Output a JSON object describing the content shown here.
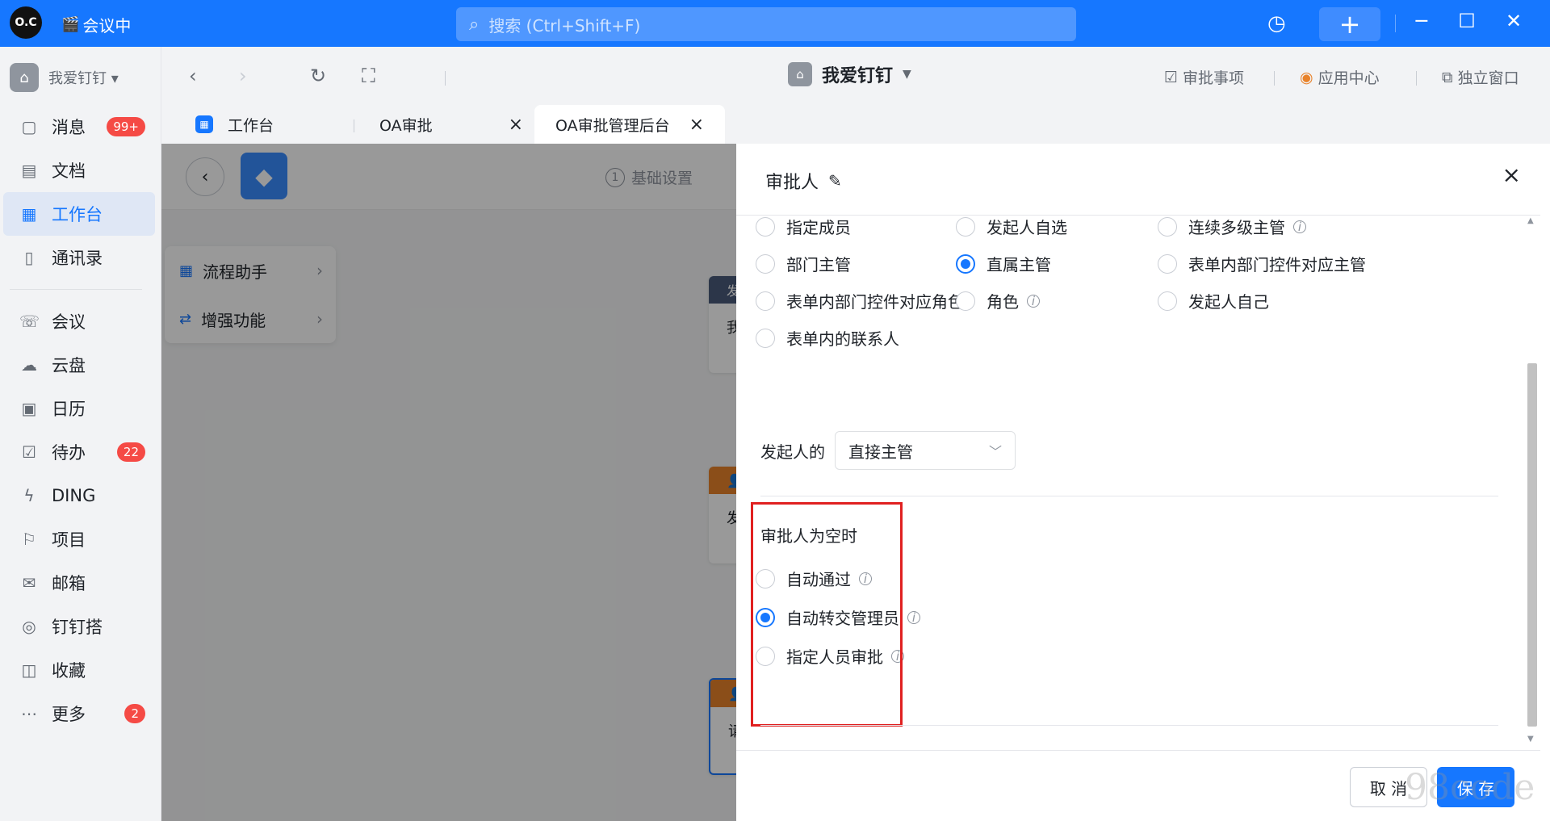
{
  "titlebar": {
    "logo_text": "O.C",
    "meeting_label": "会议中",
    "search_placeholder": "搜索 (Ctrl+Shift+F)",
    "add_label": "+",
    "minimize": "─",
    "maximize": "☐",
    "close": "✕"
  },
  "sidebar": {
    "org_name": "我爱钉钉 ▾",
    "items": [
      {
        "label": "消息",
        "icon": "message-icon",
        "glyph": "▢",
        "badge": "99+"
      },
      {
        "label": "文档",
        "icon": "doc-icon",
        "glyph": "▤",
        "badge": ""
      },
      {
        "label": "工作台",
        "icon": "workbench-icon",
        "glyph": "▦",
        "badge": "",
        "active": true
      },
      {
        "label": "通讯录",
        "icon": "contacts-icon",
        "glyph": "▯",
        "badge": ""
      },
      {
        "label": "会议",
        "icon": "meeting-icon",
        "glyph": "☏",
        "badge": ""
      },
      {
        "label": "云盘",
        "icon": "cloud-icon",
        "glyph": "☁",
        "badge": ""
      },
      {
        "label": "日历",
        "icon": "calendar-icon",
        "glyph": "▣",
        "badge": ""
      },
      {
        "label": "待办",
        "icon": "todo-icon",
        "glyph": "☑",
        "badge": "22"
      },
      {
        "label": "DING",
        "icon": "ding-icon",
        "glyph": "ϟ",
        "badge": ""
      },
      {
        "label": "项目",
        "icon": "project-icon",
        "glyph": "⚐",
        "badge": ""
      },
      {
        "label": "邮箱",
        "icon": "mail-icon",
        "glyph": "✉",
        "badge": ""
      },
      {
        "label": "钉钉搭",
        "icon": "builder-icon",
        "glyph": "◎",
        "badge": ""
      },
      {
        "label": "收藏",
        "icon": "favorites-icon",
        "glyph": "◫",
        "badge": ""
      },
      {
        "label": "更多",
        "icon": "more-icon",
        "glyph": "⋯",
        "badge": "2"
      }
    ]
  },
  "browser": {
    "back": "‹",
    "forward": "›",
    "refresh": "↻",
    "fullscreen": "⛶",
    "workspace_name": "我爱钉钉",
    "approval_items": "审批事项",
    "app_center": "应用中心",
    "standalone": "独立窗口",
    "tabs": [
      {
        "label": "工作台"
      },
      {
        "label": "OA审批"
      },
      {
        "label": "OA审批管理后台"
      }
    ]
  },
  "content": {
    "step_num": "1",
    "step_label": "基础设置",
    "menu": [
      {
        "label": "流程助手",
        "icon": "flow-icon"
      },
      {
        "label": "增强功能",
        "icon": "enhance-icon"
      }
    ],
    "nodes": [
      {
        "head": "发",
        "body": "我",
        "color": "#4a5a7a"
      },
      {
        "head": "👤",
        "body": "发",
        "color": "#e8822a"
      },
      {
        "head": "👤",
        "body": "请",
        "color": "#e8822a"
      }
    ]
  },
  "drawer": {
    "title": "审批人",
    "approver_types": [
      {
        "label": "指定成员",
        "checked": false,
        "info": false
      },
      {
        "label": "发起人自选",
        "checked": false,
        "info": false
      },
      {
        "label": "连续多级主管",
        "checked": false,
        "info": true
      },
      {
        "label": "部门主管",
        "checked": false,
        "info": false
      },
      {
        "label": "直属主管",
        "checked": true,
        "info": false
      },
      {
        "label": "表单内部门控件对应主管",
        "checked": false,
        "info": false
      },
      {
        "label": "表单内部门控件对应角色",
        "checked": false,
        "info": false
      },
      {
        "label": "角色",
        "checked": false,
        "info": true
      },
      {
        "label": "发起人自己",
        "checked": false,
        "info": false
      },
      {
        "label": "表单内的联系人",
        "checked": false,
        "info": false
      }
    ],
    "initiator_label": "发起人的",
    "initiator_select": "直接主管",
    "empty_label": "审批人为空时",
    "empty_options": [
      {
        "label": "自动通过",
        "checked": false
      },
      {
        "label": "自动转交管理员",
        "checked": true
      },
      {
        "label": "指定人员审批",
        "checked": false
      }
    ],
    "cancel_label": "取 消",
    "save_label": "保 存"
  },
  "watermark": "98code s",
  "colors": {
    "primary": "#1677ff",
    "badge": "#f54a45",
    "highlight": "#e02020"
  }
}
